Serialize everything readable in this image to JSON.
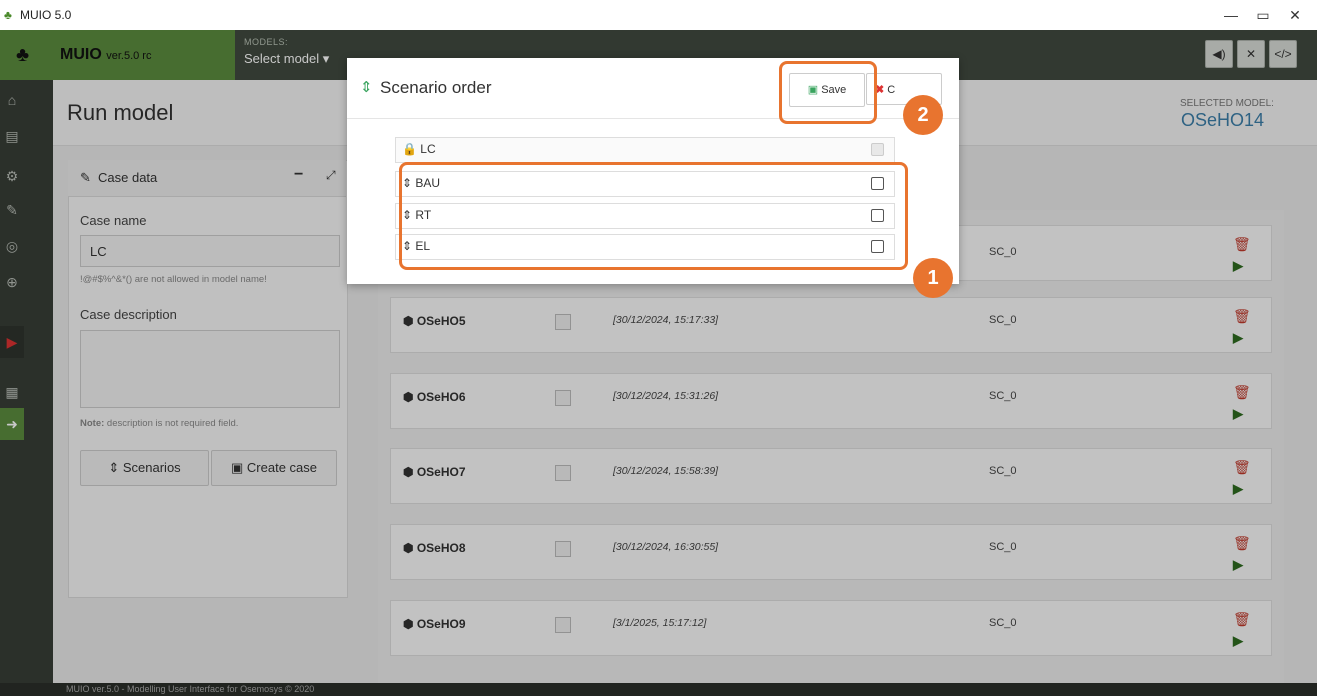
{
  "window": {
    "title": "MUIO 5.0",
    "min": "—",
    "max": "▭",
    "close": "✕"
  },
  "header": {
    "brand_name": "MUIO",
    "brand_version": "ver.5.0 rc",
    "models_label": "MODELS:",
    "models_select": "Select model ▾",
    "icons": [
      "speaker-icon",
      "expand-icon",
      "code-icon"
    ]
  },
  "sidebar": {
    "items": [
      "home-icon",
      "document-icon",
      "gears-icon",
      "edit-icon",
      "network-icon",
      "zoom-icon",
      "play-icon",
      "table-icon",
      "arrow-right-icon"
    ]
  },
  "page": {
    "title": "Run model",
    "selected_model_label": "SELECTED MODEL:",
    "selected_model": "OSeHO14"
  },
  "case_panel": {
    "title": "Case data",
    "case_name_label": "Case name",
    "case_name_value": "LC",
    "case_name_note": "!@#$%^&*() are not allowed in model name!",
    "case_desc_label": "Case description",
    "note_bold": "Note:",
    "note_text": " description is not required field.",
    "scenarios_btn": "Scenarios",
    "create_case_btn": "Create case"
  },
  "cases": [
    {
      "name": "OSeHO5",
      "date": "[30/12/2024, 15:17:33]",
      "sc": "SC_0"
    },
    {
      "name": "OSeHO6",
      "date": "[30/12/2024, 15:31:26]",
      "sc": "SC_0"
    },
    {
      "name": "OSeHO7",
      "date": "[30/12/2024, 15:58:39]",
      "sc": "SC_0"
    },
    {
      "name": "OSeHO8",
      "date": "[30/12/2024, 16:30:55]",
      "sc": "SC_0"
    },
    {
      "name": "OSeHO9",
      "date": "[3/1/2025, 15:17:12]",
      "sc": "SC_0"
    }
  ],
  "first_case_sc": "SC_0",
  "modal": {
    "title": "Scenario order",
    "save_label": "Save",
    "cancel_label": "C",
    "locked": "LC",
    "scenarios": [
      "BAU",
      "RT",
      "EL"
    ]
  },
  "annotations": {
    "badge1": "1",
    "badge2": "2"
  },
  "footer": "MUIO ver.5.0 - Modelling User Interface for Osemosys © 2020",
  "colors": {
    "brand_green": "#5b8c3e",
    "header_dark": "#404a3f",
    "accent_orange": "#e8742f",
    "link_blue": "#3b7ea8"
  }
}
